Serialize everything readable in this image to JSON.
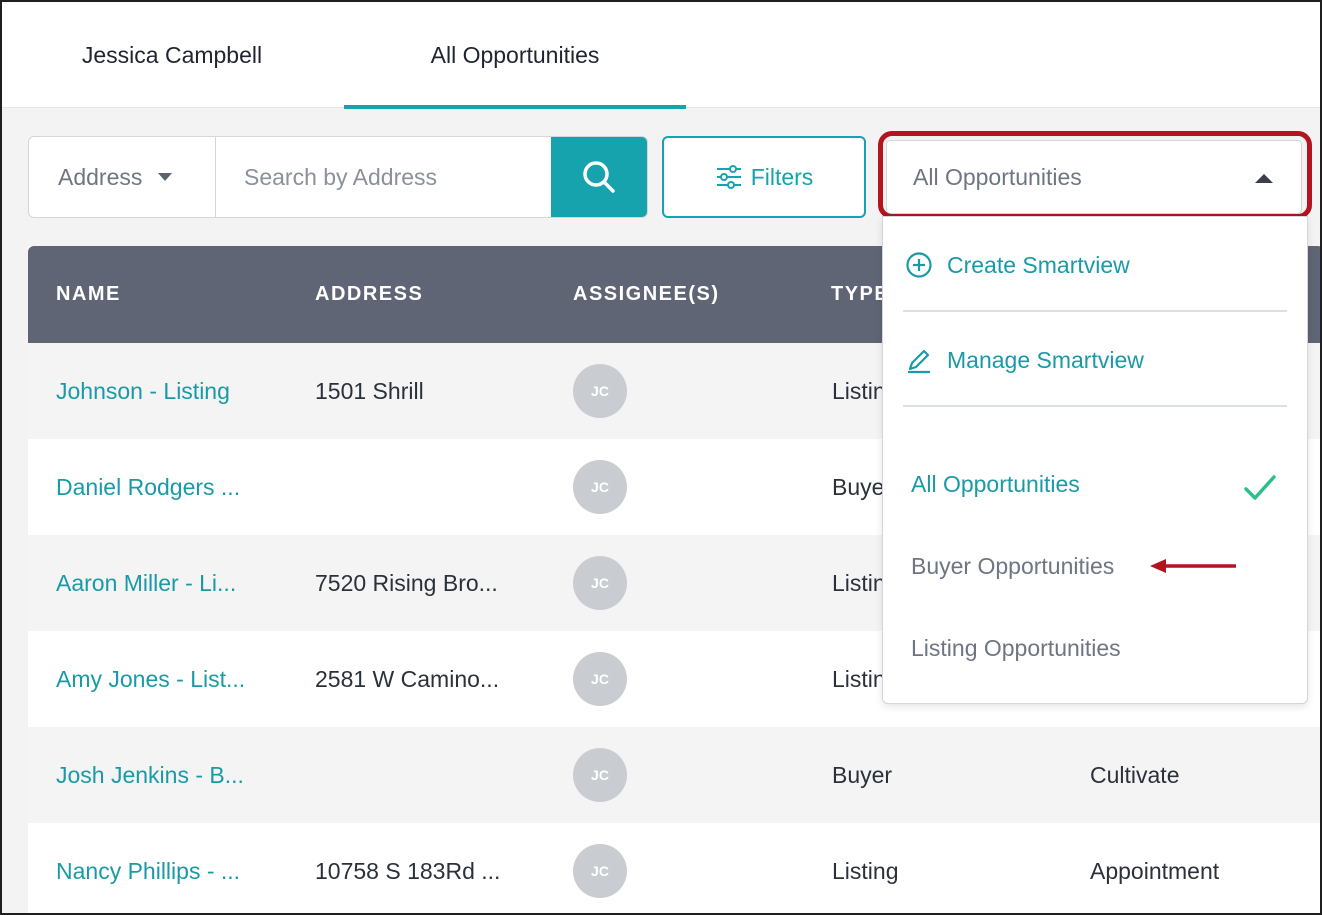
{
  "tabs": [
    {
      "label": "Jessica Campbell",
      "active": false
    },
    {
      "label": "All Opportunities",
      "active": true
    }
  ],
  "search": {
    "type_label": "Address",
    "placeholder": "Search by Address",
    "button_icon": "search-icon"
  },
  "filters": {
    "label": "Filters",
    "icon": "sliders-icon"
  },
  "smartview": {
    "selected": "All Opportunities",
    "menu": {
      "actions": [
        {
          "label": "Create Smartview",
          "icon": "plus-circle-icon"
        },
        {
          "label": "Manage Smartview",
          "icon": "pencil-icon"
        }
      ],
      "options": [
        {
          "label": "All Opportunities",
          "selected": true
        },
        {
          "label": "Buyer Opportunities",
          "selected": false
        },
        {
          "label": "Listing Opportunities",
          "selected": false
        }
      ]
    }
  },
  "table": {
    "headers": [
      "NAME",
      "ADDRESS",
      "ASSIGNEE(S)",
      "TYPE"
    ],
    "rows": [
      {
        "name": "Johnson - Listing",
        "address": "1501 Shrill",
        "assignee": "JC",
        "type": "Listing",
        "stage": ""
      },
      {
        "name": "Daniel Rodgers ...",
        "address": "",
        "assignee": "JC",
        "type": "Buyer",
        "stage": ""
      },
      {
        "name": "Aaron Miller - Li...",
        "address": "7520 Rising Bro...",
        "assignee": "JC",
        "type": "Listing",
        "stage": ""
      },
      {
        "name": "Amy Jones - List...",
        "address": "2581 W Camino...",
        "assignee": "JC",
        "type": "Listing",
        "stage": ""
      },
      {
        "name": "Josh Jenkins - B...",
        "address": "",
        "assignee": "JC",
        "type": "Buyer",
        "stage": "Cultivate"
      },
      {
        "name": "Nancy Phillips - ...",
        "address": "10758 S 183Rd ...",
        "assignee": "JC",
        "type": "Listing",
        "stage": "Appointment"
      }
    ]
  },
  "colors": {
    "accent": "#17a3ad",
    "header_bg": "#5f6575",
    "highlight": "#b3141f",
    "check": "#2bbf8a"
  }
}
